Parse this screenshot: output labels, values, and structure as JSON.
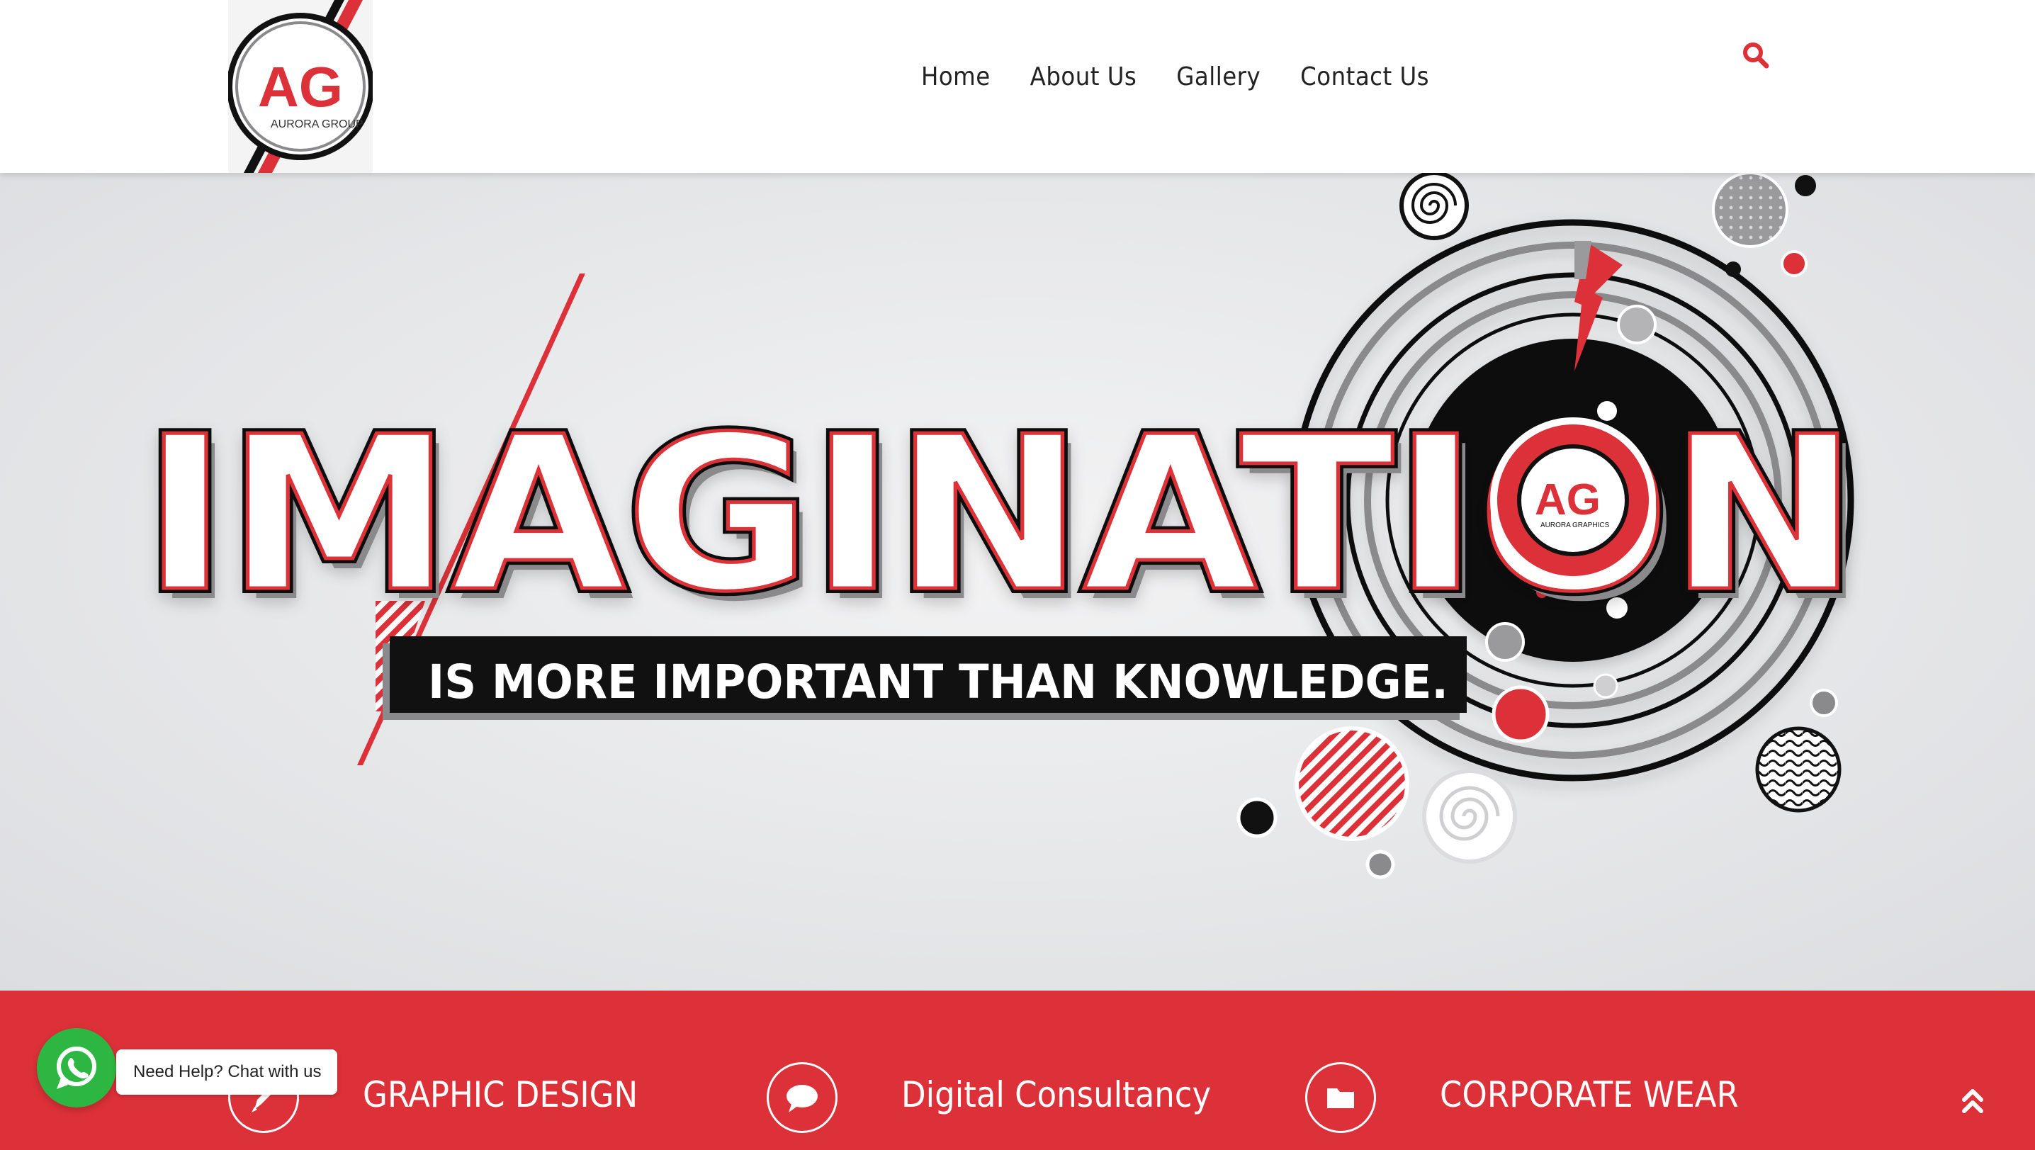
{
  "logo": {
    "monogram": "AG",
    "caption": "AURORA GROUP"
  },
  "nav": {
    "items": [
      "Home",
      "About Us",
      "Gallery",
      "Contact Us"
    ]
  },
  "search": {
    "icon": "search-icon",
    "color": "#dc3138"
  },
  "hero": {
    "headline": "IMAGINATION",
    "tagline": "IS MORE IMPORTANT THAN KNOWLEDGE.",
    "badge_monogram": "AG",
    "badge_caption": "AURORA GRAPHICS"
  },
  "services": {
    "items": [
      {
        "label": "GRAPHIC DESIGN",
        "icon": "pencil-icon"
      },
      {
        "label": "Digital Consultancy",
        "icon": "chat-bubble-icon"
      },
      {
        "label": "CORPORATE WEAR",
        "icon": "folder-icon"
      }
    ]
  },
  "whatsapp": {
    "label": "Need Help? Chat with us",
    "icon": "whatsapp-icon"
  },
  "scroll_top": {
    "icon": "double-chevron-up-icon"
  },
  "colors": {
    "brand_red": "#dc3138",
    "dark": "#111111",
    "grey": "#8a8a8c",
    "whatsapp_green": "#2db742"
  }
}
